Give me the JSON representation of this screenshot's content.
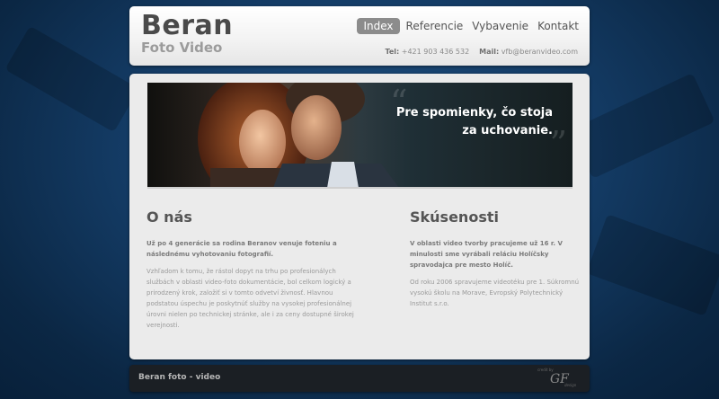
{
  "brand": {
    "title": "Beran",
    "subtitle": "Foto Video"
  },
  "nav": {
    "items": [
      {
        "label": "Index",
        "active": true
      },
      {
        "label": "Referencie",
        "active": false
      },
      {
        "label": "Vybavenie",
        "active": false
      },
      {
        "label": "Kontakt",
        "active": false
      }
    ]
  },
  "contact": {
    "phone_label": "Tel:",
    "phone": "+421 903 436 532",
    "mail_label": "Mail:",
    "mail": "vfb@beranvideo.com"
  },
  "banner": {
    "line1": "Pre spomienky, čo stoja",
    "line2": "za uchovanie."
  },
  "about": {
    "heading": "O nás",
    "lead": "Už po 4 generácie sa rodina Beranov venuje foteniu a následnému vyhotovaniu fotografií.",
    "body": "Vzhľadom k tomu, že rástol dopyt na trhu po profesionálych službách v oblasti video-foto dokumentácie, bol celkom logický a prirodzený krok, založiť si v tomto odvetví živnosť. Hlavnou podstatou úspechu je poskytnúť služby na vysokej profesionálnej úrovni nielen po technickej stránke, ale i za ceny dostupné širokej verejnosti."
  },
  "experience": {
    "heading": "Skúsenosti",
    "lead": "V oblasti video tvorby pracujeme už 16 r. V minulosti sme vyrábali reláciu Holíčsky spravodajca pre mesto Holíč.",
    "body": "Od roku 2006 spravujeme videotéku pre 1. Súkromnú vysokú školu na Morave, Evropský Polytechnický Institut s.r.o."
  },
  "footer": {
    "text": "Beran foto - video",
    "credit_small": "credit by",
    "credit_mark": "GF",
    "credit_sub": "design"
  },
  "colors": {
    "background": "#143c66",
    "panel": "#ebebeb",
    "nav_active": "#8c8c8c",
    "footer": "#1b1f24"
  }
}
